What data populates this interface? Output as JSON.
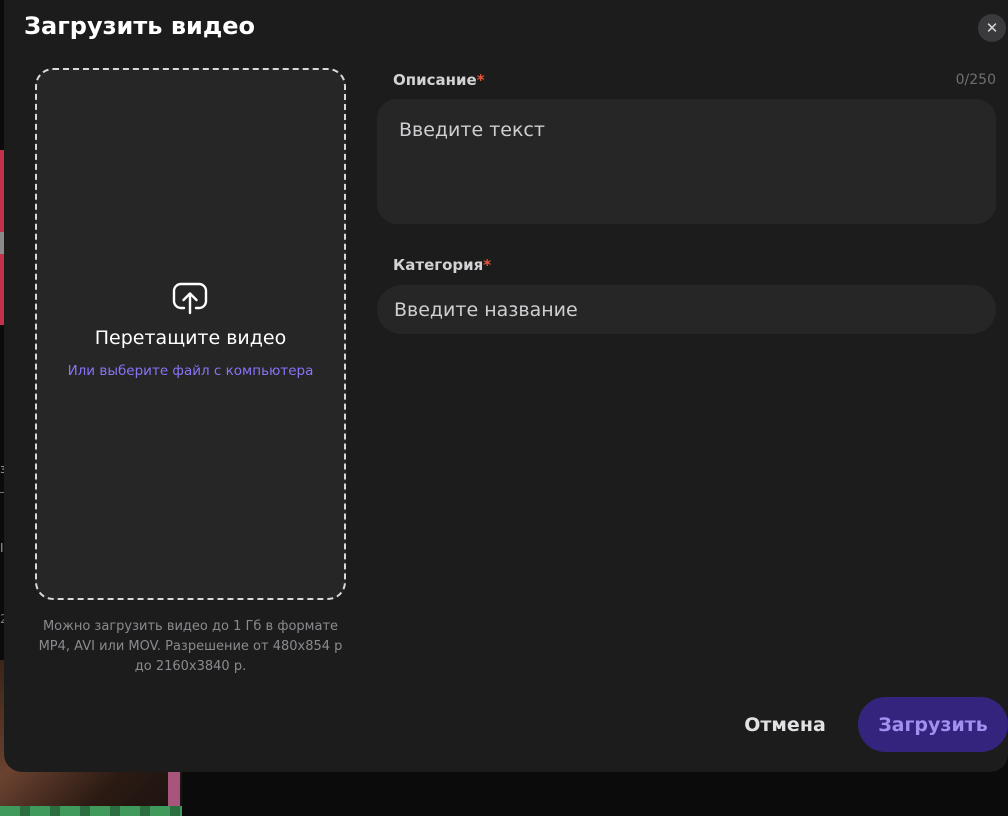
{
  "modal": {
    "title": "Загрузить видео",
    "close_icon": "close-icon"
  },
  "dropzone": {
    "icon": "upload-icon",
    "title": "Перетащите видео",
    "link": "Или выберите файл с компьютера",
    "hint": "Можно загрузить видео до 1 Гб в формате MP4, AVI или MOV. Разрешение от 480x854 р до 2160x3840 р."
  },
  "description": {
    "label": "Описание",
    "required_mark": "*",
    "counter": "0/250",
    "placeholder": "Введите текст",
    "value": ""
  },
  "category": {
    "label": "Категория",
    "required_mark": "*",
    "placeholder": "Введите название",
    "value": ""
  },
  "actions": {
    "cancel": "Отмена",
    "submit": "Загрузить"
  },
  "colors": {
    "modal_bg": "#1c1c1d",
    "field_bg": "#262627",
    "link": "#8a73f5",
    "required": "#e8553a",
    "submit_bg": "#35247e",
    "submit_text": "#a38ff0"
  }
}
